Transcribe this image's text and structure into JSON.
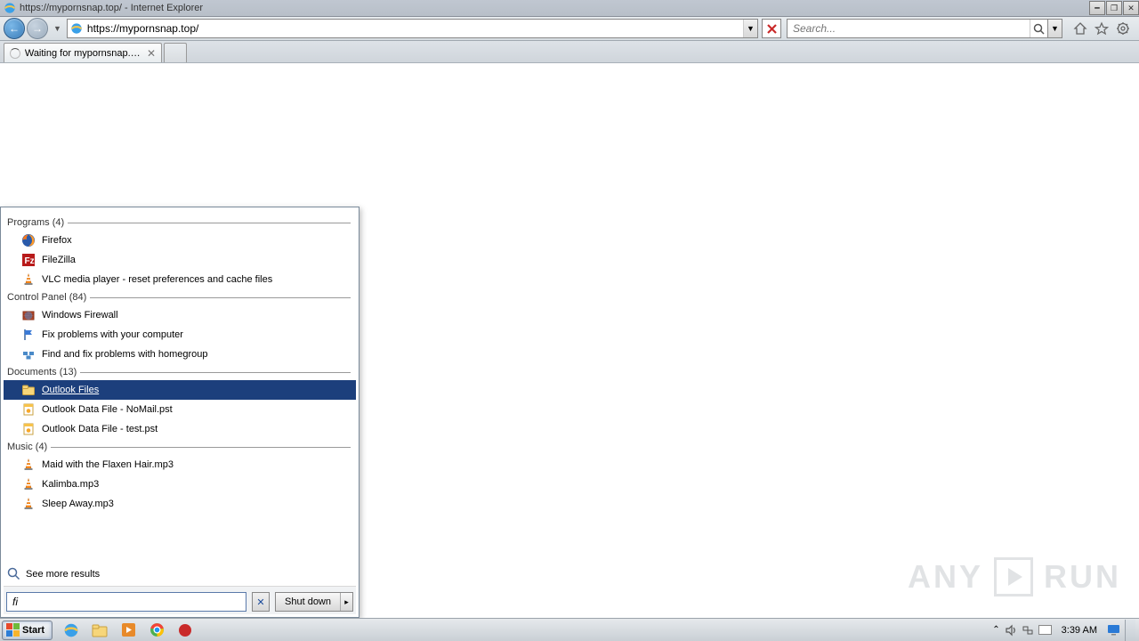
{
  "titlebar": {
    "text": "https://mypornsnap.top/ - Internet Explorer"
  },
  "navbar": {
    "url": "https://mypornsnap.top/",
    "search_placeholder": "Search..."
  },
  "tab": {
    "label": "Waiting for mypornsnap.top"
  },
  "startmenu": {
    "sections": [
      {
        "heading": "Programs (4)",
        "items": [
          {
            "label": "Firefox",
            "icon": "firefox"
          },
          {
            "label": "FileZilla",
            "icon": "filezilla"
          },
          {
            "label": "VLC media player - reset preferences and cache files",
            "icon": "vlc"
          }
        ]
      },
      {
        "heading": "Control Panel (84)",
        "items": [
          {
            "label": "Windows Firewall",
            "icon": "firewall"
          },
          {
            "label": "Fix problems with your computer",
            "icon": "flag"
          },
          {
            "label": "Find and fix problems with homegroup",
            "icon": "homegroup"
          }
        ]
      },
      {
        "heading": "Documents (13)",
        "items": [
          {
            "label": "Outlook Files",
            "icon": "folder",
            "selected": true
          },
          {
            "label": "Outlook Data File - NoMail.pst",
            "icon": "pst"
          },
          {
            "label": "Outlook Data File - test.pst",
            "icon": "pst"
          }
        ]
      },
      {
        "heading": "Music (4)",
        "items": [
          {
            "label": "Maid with the Flaxen Hair.mp3",
            "icon": "vlc"
          },
          {
            "label": "Kalimba.mp3",
            "icon": "vlc"
          },
          {
            "label": "Sleep Away.mp3",
            "icon": "vlc"
          }
        ]
      }
    ],
    "more": "See more results",
    "search_value": "fi",
    "shutdown": "Shut down"
  },
  "taskbar": {
    "start": "Start",
    "clock": "3:39 AM"
  },
  "watermark": {
    "left": "ANY",
    "right": "RUN"
  }
}
